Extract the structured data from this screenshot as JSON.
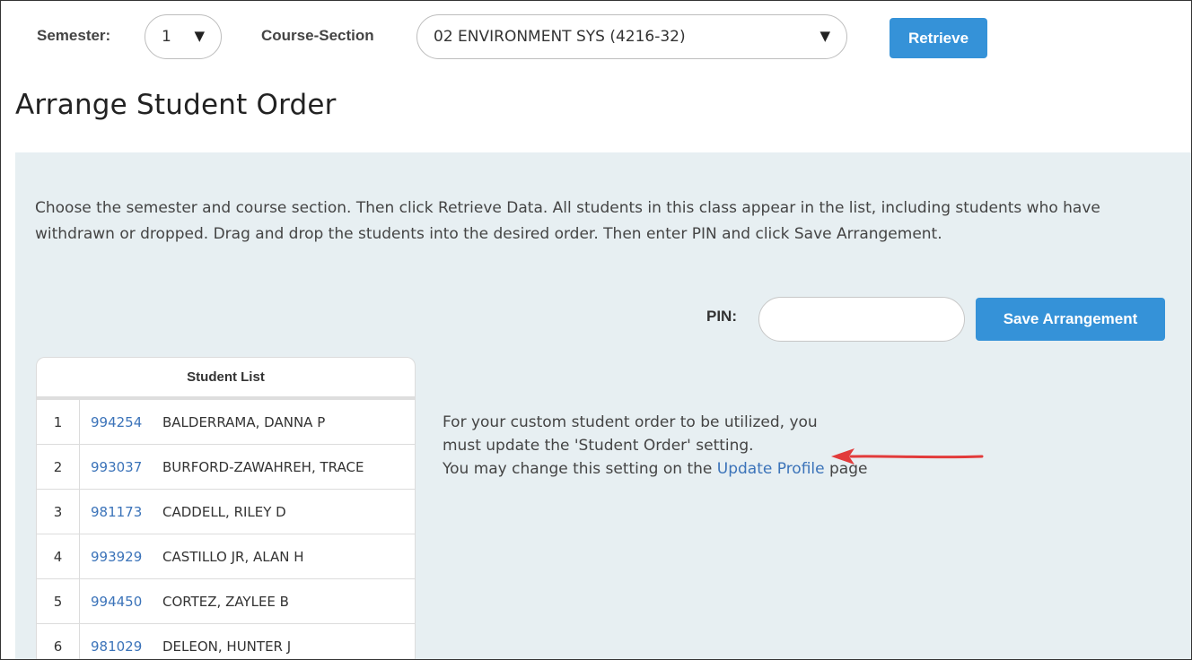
{
  "toolbar": {
    "semester_label": "Semester:",
    "semester_value": "1",
    "course_section_label": "Course-Section",
    "course_section_value": "02 ENVIRONMENT SYS (4216-32)",
    "retrieve_label": "Retrieve"
  },
  "page": {
    "title": "Arrange Student Order"
  },
  "main": {
    "instructions": "Choose the semester and course section. Then click Retrieve Data. All students in this class appear in the list, including students who have withdrawn or dropped. Drag and drop the students into the desired order. Then enter PIN and click Save Arrangement.",
    "pin_label": "PIN:",
    "pin_value": "",
    "save_label": "Save Arrangement",
    "student_list": {
      "header": "Student List",
      "rows": [
        {
          "num": "1",
          "id": "994254",
          "name": "BALDERRAMA, DANNA P"
        },
        {
          "num": "2",
          "id": "993037",
          "name": "BURFORD-ZAWAHREH, TRACE"
        },
        {
          "num": "3",
          "id": "981173",
          "name": "CADDELL, RILEY D"
        },
        {
          "num": "4",
          "id": "993929",
          "name": "CASTILLO JR, ALAN H"
        },
        {
          "num": "5",
          "id": "994450",
          "name": "CORTEZ, ZAYLEE B"
        },
        {
          "num": "6",
          "id": "981029",
          "name": "DELEON, HUNTER J"
        }
      ]
    },
    "note": {
      "line1": "For your custom student order to be utilized, you",
      "line2": "must update the 'Student Order' setting.",
      "line3_prefix": "You may change this setting on the ",
      "line3_link": "Update Profile",
      "line3_suffix": " page"
    }
  },
  "colors": {
    "accent": "#3592d8",
    "link": "#3b73b9",
    "panel_bg": "#e7eff2",
    "arrow": "#e23b3b"
  },
  "icons": {
    "select_caret": "caret-down-icon",
    "annotation": "red-arrow-icon"
  }
}
